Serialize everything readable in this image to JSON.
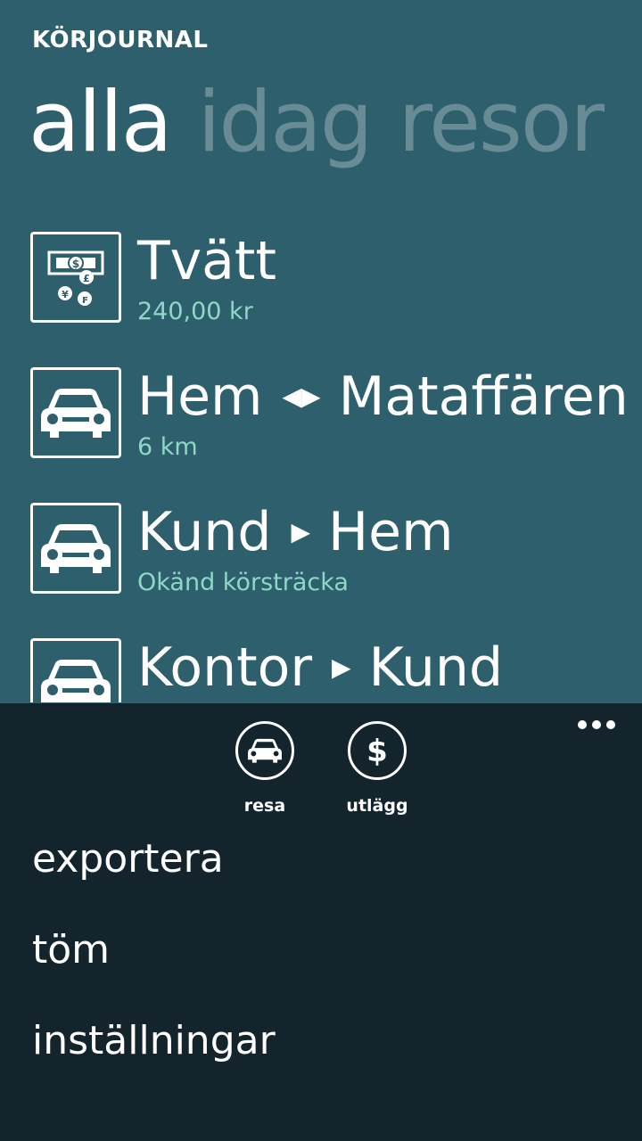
{
  "app": {
    "title": "KÖRJOURNAL"
  },
  "pivot": {
    "tabs": [
      {
        "label": "alla",
        "active": true
      },
      {
        "label": "idag",
        "active": false
      },
      {
        "label": "resor",
        "active": false
      }
    ]
  },
  "entries": [
    {
      "icon": "money-icon",
      "title": "Tvätt",
      "from": "",
      "connector": "",
      "to": "",
      "subtitle": "240,00 kr"
    },
    {
      "icon": "car-icon",
      "title": "",
      "from": "Hem",
      "connector": "◀▶",
      "to": "Mataffären",
      "subtitle": "6 km"
    },
    {
      "icon": "car-icon",
      "title": "",
      "from": "Kund",
      "connector": "▶",
      "to": "Hem",
      "subtitle": "Okänd körsträcka"
    },
    {
      "icon": "car-icon",
      "title": "",
      "from": "Kontor",
      "connector": "▶",
      "to": "Kund",
      "subtitle": ""
    }
  ],
  "appbar": {
    "buttons": [
      {
        "label": "resa",
        "icon": "car-icon"
      },
      {
        "label": "utlägg",
        "icon": "dollar-icon"
      }
    ],
    "menu": [
      "exportera",
      "töm",
      "inställningar"
    ]
  },
  "colors": {
    "background": "#2e5f6d",
    "accent": "#8fd7c7",
    "appbar": "#13242c"
  }
}
